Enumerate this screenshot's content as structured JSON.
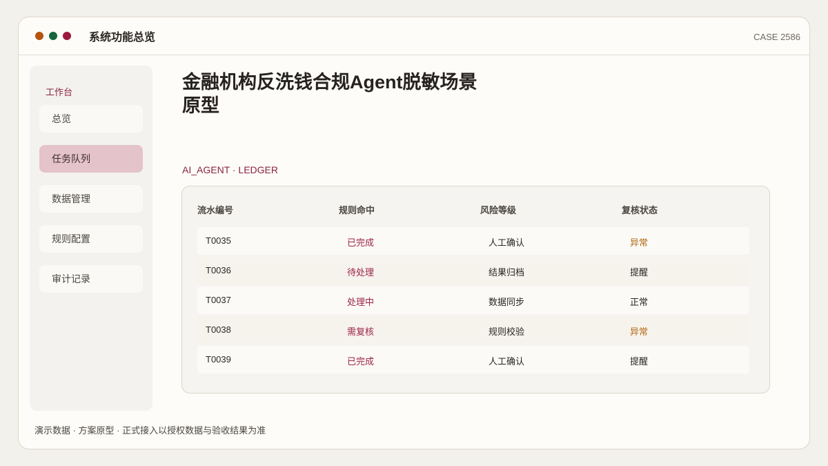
{
  "window": {
    "title": "系统功能总览",
    "case_id": "CASE 2586",
    "dots": [
      "#b5540f",
      "#17643d",
      "#9c1a3e"
    ]
  },
  "sidebar": {
    "heading": "工作台",
    "items": [
      {
        "label": "总览",
        "active": false
      },
      {
        "label": "任务队列",
        "active": true
      },
      {
        "label": "数据管理",
        "active": false
      },
      {
        "label": "规则配置",
        "active": false
      },
      {
        "label": "审计记录",
        "active": false
      }
    ]
  },
  "main": {
    "title": "金融机构反洗钱合规Agent脱敏场景原型",
    "subtitle": "AI_AGENT · LEDGER",
    "table": {
      "headers": [
        "流水编号",
        "规则命中",
        "风险等级",
        "复核状态"
      ],
      "rows": [
        {
          "id": "T0035",
          "rule": "已完成",
          "risk": "人工确认",
          "status": "异常"
        },
        {
          "id": "T0036",
          "rule": "待处理",
          "risk": "结果归档",
          "status": "提醒"
        },
        {
          "id": "T0037",
          "rule": "处理中",
          "risk": "数据同步",
          "status": "正常"
        },
        {
          "id": "T0038",
          "rule": "需复核",
          "risk": "规则校验",
          "status": "异常"
        },
        {
          "id": "T0039",
          "rule": "已完成",
          "risk": "人工确认",
          "status": "提醒"
        }
      ]
    }
  },
  "footer": {
    "note": "演示数据 · 方案原型 · 正式接入以授权数据与验收结果为准"
  },
  "colors": {
    "accent": "#8a2243",
    "status_warn": "#b26a16",
    "active_item_bg": "#e4c3ca"
  }
}
